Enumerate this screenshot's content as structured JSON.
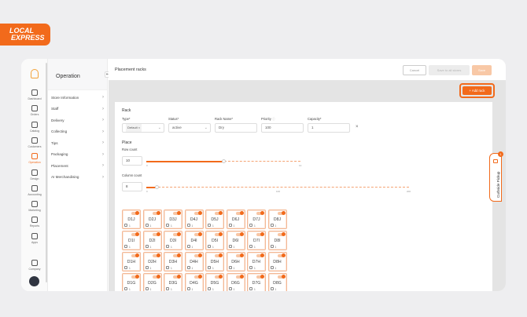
{
  "brand": {
    "line1": "LOCAL",
    "line2": "EXPRESS",
    "color": "#f26a1b"
  },
  "rail": [
    {
      "label": "Dashboard",
      "icon": "home-icon"
    },
    {
      "label": "Orders",
      "icon": "bag-icon"
    },
    {
      "label": "Catalog",
      "icon": "catalog-icon"
    },
    {
      "label": "Customers",
      "icon": "users-icon"
    },
    {
      "label": "Operation",
      "icon": "operation-icon",
      "active": true
    },
    {
      "label": "Design",
      "icon": "design-icon"
    },
    {
      "label": "Accounting",
      "icon": "accounting-icon"
    },
    {
      "label": "Marketing",
      "icon": "megaphone-icon"
    },
    {
      "label": "Reports",
      "icon": "reports-icon"
    },
    {
      "label": "Apps",
      "icon": "apps-icon"
    },
    {
      "label": "Company",
      "icon": "company-icon"
    }
  ],
  "submenu": {
    "title": "Operation",
    "items": [
      "Store Information",
      "Staff",
      "Delivery",
      "Collecting",
      "Tips",
      "Packaging",
      "Placement",
      "AI Merchandising"
    ]
  },
  "toolbar": {
    "title": "Placement racks",
    "cancel": "Cancel",
    "save_all": "Save to all stores",
    "save": "Save",
    "add_rack": "+ Add rack"
  },
  "rack": {
    "section": "Rack",
    "type_label": "Type*",
    "type_value": "Default",
    "status_label": "Status*",
    "status_value": "active",
    "name_label": "Rack Name*",
    "name_value": "Dry",
    "priority_label": "Priority",
    "priority_value": "100",
    "capacity_label": "Capacity*",
    "capacity_value": "1"
  },
  "place": {
    "section": "Place",
    "row_label": "Row count",
    "row_value": 10,
    "row_ticks": [
      "0",
      "10"
    ],
    "row_max": 10,
    "col_label": "Column count",
    "col_value": 8,
    "col_ticks": [
      "0",
      "100",
      "200"
    ],
    "col_max": 200
  },
  "grid": {
    "columns": [
      "D1",
      "D2",
      "D3",
      "D4",
      "D5",
      "D6",
      "D7",
      "D8"
    ],
    "rows": [
      "J",
      "I",
      "H",
      "G"
    ],
    "capacity": "1"
  },
  "side_tab": {
    "label": "Curbside Pickup",
    "badge": "1"
  }
}
